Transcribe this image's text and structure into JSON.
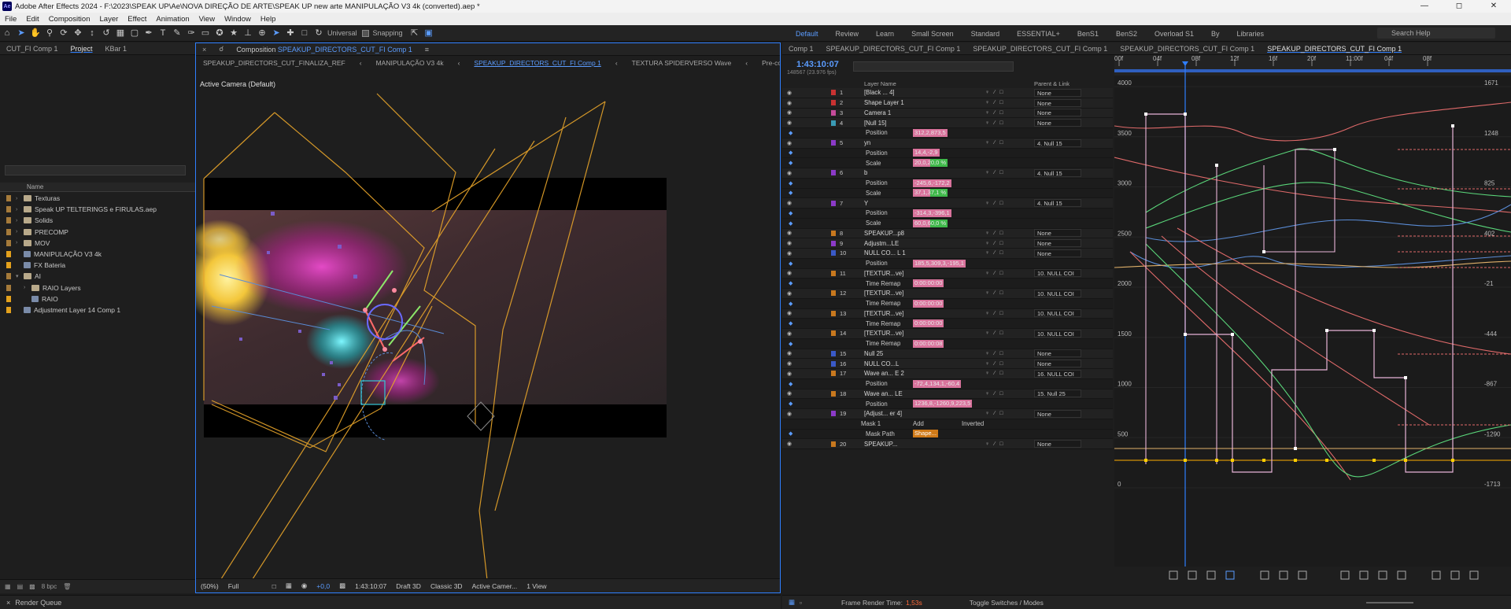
{
  "window": {
    "title": "Adobe After Effects 2024 - F:\\2023\\SPEAK UP\\Ae\\NOVA DIREÇÃO DE ARTE\\SPEAK UP new arte MANIPULAÇÃO V3 4k (converted).aep *",
    "logo": "Ae"
  },
  "menu": [
    "File",
    "Edit",
    "Composition",
    "Layer",
    "Effect",
    "Animation",
    "View",
    "Window",
    "Help"
  ],
  "toolbar": {
    "universal_label": "Universal",
    "snapping_label": "Snapping",
    "workspaces": [
      "Default",
      "Review",
      "Learn",
      "Small Screen",
      "Standard",
      "ESSENTIAL+",
      "BenS1",
      "BenS2",
      "Overload S1",
      "By",
      "Libraries"
    ],
    "active_workspace": "Default",
    "search_placeholder": "Search Help"
  },
  "project": {
    "tabs": [
      "CUT_FI Comp 1",
      "Project",
      "KBar 1"
    ],
    "column_name": "Name",
    "items": [
      {
        "name": "Texturas",
        "type": "folder",
        "color": "#a57a3a",
        "expanded": false
      },
      {
        "name": "Speak UP TELTERINGS e FIRULAS.aep",
        "type": "folder",
        "color": "#a57a3a",
        "expanded": false
      },
      {
        "name": "Solids",
        "type": "folder",
        "color": "#a57a3a",
        "expanded": false
      },
      {
        "name": "PRECOMP",
        "type": "folder",
        "color": "#a57a3a",
        "expanded": false
      },
      {
        "name": "MOV",
        "type": "folder",
        "color": "#a57a3a",
        "expanded": false
      },
      {
        "name": "MANIPULAÇÃO V3 4k",
        "type": "comp",
        "color": "#e3a11c",
        "expanded": false
      },
      {
        "name": "FX Bateria",
        "type": "comp",
        "color": "#e3a11c",
        "expanded": false
      },
      {
        "name": "AI",
        "type": "folder",
        "color": "#a57a3a",
        "expanded": true
      },
      {
        "name": "RAIO Layers",
        "type": "folder",
        "color": "#a57a3a",
        "expanded": false
      },
      {
        "name": "RAIO",
        "type": "comp",
        "color": "#e3a11c",
        "expanded": false
      },
      {
        "name": "Adjustment Layer 14 Comp 1",
        "type": "comp",
        "color": "#e3a11c",
        "expanded": false
      }
    ],
    "bpc": "8 bpc"
  },
  "composition": {
    "tab_label": "Composition",
    "tab_name": "SPEAKUP_DIRECTORS_CUT_FI Comp 1",
    "breadcrumbs": [
      "SPEAKUP_DIRECTORS_CUT_FINALIZA_REF",
      "MANIPULAÇÃO V3 4k",
      "SPEAKUP_DIRECTORS_CUT_FI Comp 1",
      "TEXTURA SPIDERVERSO Wave",
      "Pre-comp 2"
    ],
    "active_breadcrumb": 2,
    "camera_label": "Active Camera (Default)",
    "footer": {
      "zoom": "(50%)",
      "resolution": "Full",
      "exposure": "+0,0",
      "timecode": "1:43:10:07",
      "draft": "Draft 3D",
      "renderer": "Classic 3D",
      "camera": "Active Camer...",
      "views": "1 View"
    }
  },
  "render_queue": {
    "label": "Render Queue"
  },
  "timeline": {
    "tabs": [
      "Comp 1",
      "SPEAKUP_DIRECTORS_CUT_FI Comp 1",
      "SPEAKUP_DIRECTORS_CUT_FI Comp 1",
      "SPEAKUP_DIRECTORS_CUT_FI Comp 1",
      "SPEAKUP_DIRECTORS_CUT_FI Comp 1"
    ],
    "timecode": "1:43:10:07",
    "frames": "148567 (23.976 fps)",
    "col_layer_name": "Layer Name",
    "col_parent": "Parent & Link",
    "rows": [
      {
        "kind": "layer",
        "num": "1",
        "name": "[Black ... 4]",
        "color": "#c83232",
        "parent": "None"
      },
      {
        "kind": "layer",
        "num": "2",
        "name": "Shape Layer 1",
        "color": "#c83232",
        "parent": "None"
      },
      {
        "kind": "layer",
        "num": "3",
        "name": "Camera 1",
        "color": "#c64b9a",
        "parent": "None"
      },
      {
        "kind": "layer",
        "num": "4",
        "name": "[Null 15]",
        "color": "#3a9ab4",
        "parent": "None"
      },
      {
        "kind": "prop",
        "name": "Position",
        "value": "312,2,873,5"
      },
      {
        "kind": "layer",
        "num": "5",
        "name": "yn",
        "color": "#8c3ac8",
        "parent": "4. Null 15"
      },
      {
        "kind": "prop",
        "name": "Position",
        "value": "14,4,-2,9"
      },
      {
        "kind": "prop",
        "name": "Scale",
        "value": "20,0,20,0 %",
        "split": true
      },
      {
        "kind": "layer",
        "num": "6",
        "name": "b",
        "color": "#8c3ac8",
        "parent": "4. Null 15"
      },
      {
        "kind": "prop",
        "name": "Position",
        "value": "-245,6,-172,2"
      },
      {
        "kind": "prop",
        "name": "Scale",
        "value": "37,1,37,1 %",
        "split": true
      },
      {
        "kind": "layer",
        "num": "7",
        "name": "Y",
        "color": "#8c3ac8",
        "parent": "4. Null 15"
      },
      {
        "kind": "prop",
        "name": "Position",
        "value": "-314,3,-396,1"
      },
      {
        "kind": "prop",
        "name": "Scale",
        "value": "60,0,60,0 %",
        "split": true
      },
      {
        "kind": "layer",
        "num": "8",
        "name": "SPEAKUP...p8",
        "color": "#c8781e",
        "parent": "None"
      },
      {
        "kind": "layer",
        "num": "9",
        "name": "Adjustm...LE",
        "color": "#8c3ac8",
        "parent": "None"
      },
      {
        "kind": "layer",
        "num": "10",
        "name": "NULL CO... L 1",
        "color": "#3a5ac8",
        "parent": "None"
      },
      {
        "kind": "prop",
        "name": "Position",
        "value": "185,5,309,3,-195,1"
      },
      {
        "kind": "layer",
        "num": "11",
        "name": "[TEXTUR...ve]",
        "color": "#c8781e",
        "parent": "10. NULL COI"
      },
      {
        "kind": "prop",
        "name": "Time Remap",
        "value": "0:00:00:00"
      },
      {
        "kind": "layer",
        "num": "12",
        "name": "[TEXTUR...ve]",
        "color": "#c8781e",
        "parent": "10. NULL COI"
      },
      {
        "kind": "prop",
        "name": "Time Remap",
        "value": "0:00:00:00"
      },
      {
        "kind": "layer",
        "num": "13",
        "name": "[TEXTUR...ve]",
        "color": "#c8781e",
        "parent": "10. NULL COI"
      },
      {
        "kind": "prop",
        "name": "Time Remap",
        "value": "0:00:00:00"
      },
      {
        "kind": "layer",
        "num": "14",
        "name": "[TEXTUR...ve]",
        "color": "#c8781e",
        "parent": "10. NULL COI"
      },
      {
        "kind": "prop",
        "name": "Time Remap",
        "value": "0:00:00:08"
      },
      {
        "kind": "layer",
        "num": "15",
        "name": "Null 25",
        "color": "#3a5ac8",
        "parent": "None"
      },
      {
        "kind": "layer",
        "num": "16",
        "name": "NULL CO...L",
        "color": "#3a5ac8",
        "parent": "None"
      },
      {
        "kind": "layer",
        "num": "17",
        "name": "Wave an... E 2",
        "color": "#c8781e",
        "parent": "16. NULL COI"
      },
      {
        "kind": "prop",
        "name": "Position",
        "value": "-72,4,134,1,-60,4"
      },
      {
        "kind": "layer",
        "num": "18",
        "name": "Wave an... LE",
        "color": "#c8781e",
        "parent": "15. Null 25"
      },
      {
        "kind": "prop",
        "name": "Position",
        "value": "1236,8,-1260,9,223,5"
      },
      {
        "kind": "layer",
        "num": "19",
        "name": "[Adjust... er 4]",
        "color": "#8c3ac8",
        "parent": "None"
      },
      {
        "kind": "mask",
        "name": "Mask 1",
        "mode": "Add",
        "inverted": "Inverted"
      },
      {
        "kind": "prop",
        "name": "Mask Path",
        "value": "Shape...",
        "orange": true
      },
      {
        "kind": "layer",
        "num": "20",
        "name": "SPEAKUP...",
        "color": "#c8781e",
        "parent": "None"
      }
    ],
    "ruler": [
      "00f",
      "04f",
      "08f",
      "12f",
      "16f",
      "20f",
      "11:00f",
      "04f",
      "08f"
    ],
    "graph_left_labels": [
      "4000",
      "3500",
      "3000",
      "2500",
      "2000",
      "1500",
      "1000",
      "500",
      "0"
    ],
    "graph_right_labels": [
      "1671",
      "1248",
      "825",
      "402",
      "-21",
      "-444",
      "-867",
      "-1290",
      "-1713"
    ],
    "footer": {
      "frame_render_label": "Frame Render Time:",
      "frame_render_value": "1,53s",
      "toggle": "Toggle Switches / Modes"
    }
  }
}
